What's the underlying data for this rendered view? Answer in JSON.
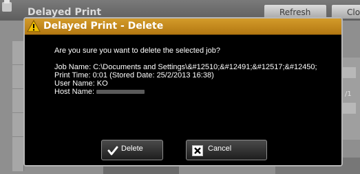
{
  "background": {
    "title": "Delayed Print",
    "refresh_label": "Refresh",
    "close_label": "Close",
    "page_indicator": "/1"
  },
  "dialog": {
    "title": "Delayed Print - Delete",
    "confirm_message": "Are you sure you want to delete the selected job?",
    "job_name": "Job Name: C:\\Documents and Settings\\&#12510;&#12491;&#12517;&#12450;",
    "print_time": "Print Time: 0:01 (Stored Date: 25/2/2013 16:38)",
    "user_name": "User Name: KO",
    "host_name_label": "Host Name:",
    "delete_label": "Delete",
    "cancel_label": "Cancel"
  },
  "colors": {
    "header_accent": "#c68a1c",
    "dialog_background": "#000000",
    "warning_icon": "#f2c200"
  },
  "icons": {
    "warning": "warning-triangle-icon",
    "delete": "checkmark-icon",
    "cancel": "x-box-icon"
  }
}
